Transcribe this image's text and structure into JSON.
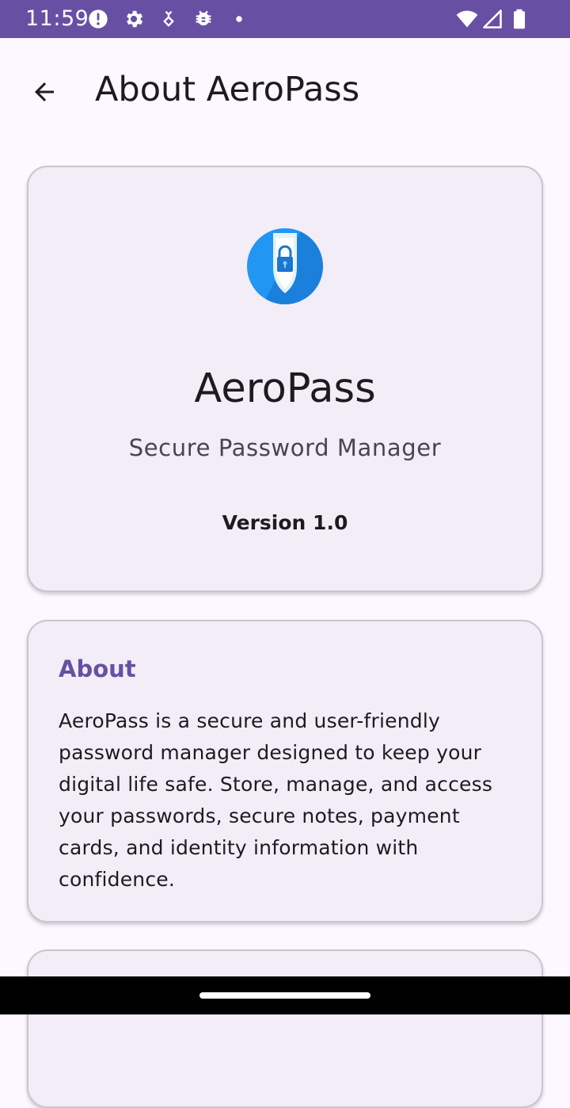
{
  "status_bar": {
    "time": "11:59",
    "left_icons": [
      "alert-circle-icon",
      "settings-gear-icon",
      "usb-debug-icon",
      "bug-icon",
      "notification-dot-icon"
    ],
    "right_icons": [
      "wifi-icon",
      "cell-signal-icon",
      "battery-icon"
    ],
    "background_color": "#6750A4"
  },
  "app_bar": {
    "back_icon": "arrow-back-icon",
    "title": "About AeroPass"
  },
  "header_card": {
    "logo_icon": "shield-lock-logo-icon",
    "app_name": "AeroPass",
    "tagline": "Secure Password Manager",
    "version": "Version 1.0"
  },
  "about_card": {
    "title": "About",
    "body": "AeroPass is a secure and user-friendly password manager designed to keep your digital life safe. Store, manage, and access your passwords, secure notes, payment cards, and identity information with confidence."
  },
  "colors": {
    "primary": "#6750A4",
    "background": "#FDF7FF",
    "card_surface": "#F3EDF7",
    "logo_blue": "#2196F3"
  }
}
